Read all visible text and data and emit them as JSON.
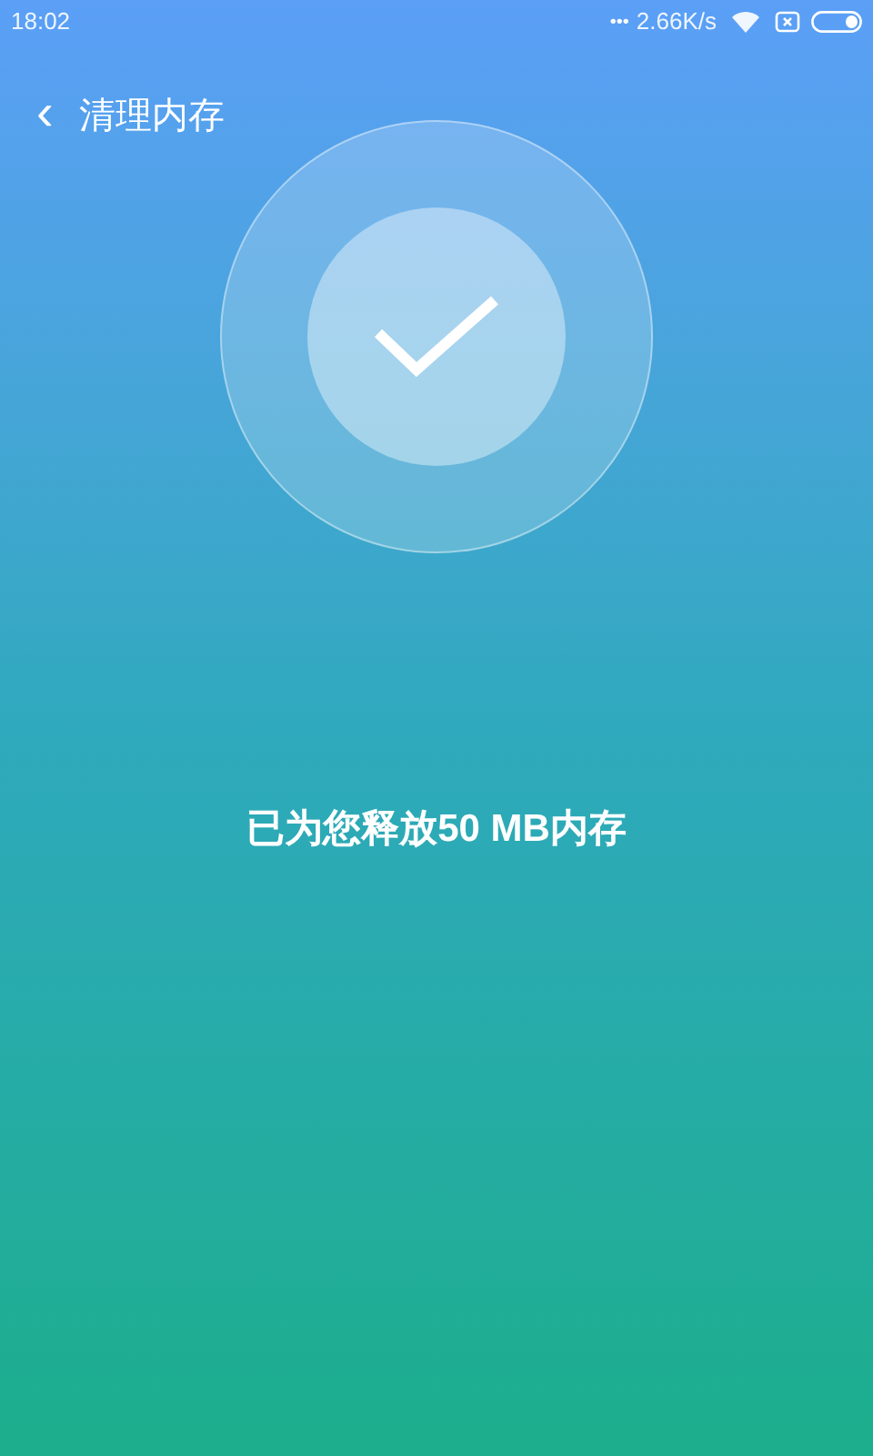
{
  "status_bar": {
    "time": "18:02",
    "dots": "•••",
    "speed": "2.66K/s"
  },
  "header": {
    "back": "‹",
    "title": "清理内存"
  },
  "result": {
    "message": "已为您释放50 MB内存"
  }
}
